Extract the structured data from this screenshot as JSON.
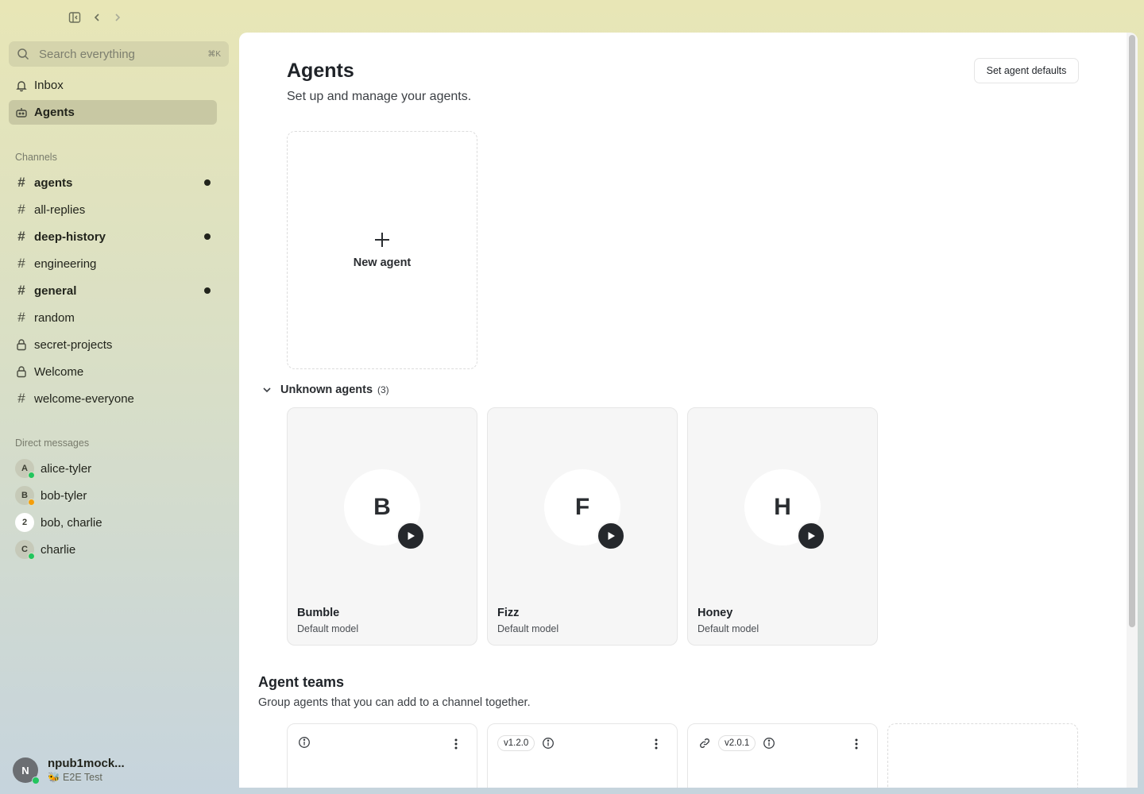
{
  "topbar": {
    "icons": [
      "sidebar-toggle-icon",
      "back-arrow-icon",
      "forward-arrow-icon"
    ]
  },
  "sidebar": {
    "search": {
      "placeholder": "Search everything",
      "shortcut": "⌘K"
    },
    "nav": [
      {
        "label": "Inbox",
        "icon": "bell-icon",
        "active": false
      },
      {
        "label": "Agents",
        "icon": "bot-icon",
        "active": true
      }
    ],
    "channels_label": "Channels",
    "channels": [
      {
        "name": "agents",
        "icon": "hash",
        "unread": true
      },
      {
        "name": "all-replies",
        "icon": "hash",
        "unread": false
      },
      {
        "name": "deep-history",
        "icon": "hash",
        "unread": true
      },
      {
        "name": "engineering",
        "icon": "hash",
        "unread": false
      },
      {
        "name": "general",
        "icon": "hash",
        "unread": true
      },
      {
        "name": "random",
        "icon": "hash",
        "unread": false
      },
      {
        "name": "secret-projects",
        "icon": "lock",
        "unread": false
      },
      {
        "name": "Welcome",
        "icon": "lock",
        "unread": false
      },
      {
        "name": "welcome-everyone",
        "icon": "hash",
        "unread": false
      }
    ],
    "dm_label": "Direct messages",
    "dms": [
      {
        "name": "alice-tyler",
        "initial": "A",
        "presence": "#22c55e"
      },
      {
        "name": "bob-tyler",
        "initial": "B",
        "presence": "#f59e0b"
      },
      {
        "name": "bob, charlie",
        "initial": "2",
        "presence": ""
      },
      {
        "name": "charlie",
        "initial": "C",
        "presence": "#22c55e"
      }
    ],
    "user": {
      "initial": "N",
      "name": "npub1mock...",
      "status": "🐝 E2E Test"
    }
  },
  "main": {
    "title": "Agents",
    "subtitle": "Set up and manage your agents.",
    "defaults_button": "Set agent defaults",
    "new_agent_label": "New agent",
    "unknown_group": {
      "label": "Unknown agents",
      "count": "(3)"
    },
    "agents": [
      {
        "initial": "B",
        "name": "Bumble",
        "model": "Default model"
      },
      {
        "initial": "F",
        "name": "Fizz",
        "model": "Default model"
      },
      {
        "initial": "H",
        "name": "Honey",
        "model": "Default model"
      }
    ],
    "teams_title": "Agent teams",
    "teams_subtitle": "Group agents that you can add to a channel together.",
    "teams": [
      {
        "version": "",
        "link": false
      },
      {
        "version": "v1.2.0",
        "link": false
      },
      {
        "version": "v2.0.1",
        "link": true
      }
    ]
  },
  "colors": {
    "accent_dark": "#25282c",
    "online": "#22c55e",
    "away": "#f59e0b"
  }
}
